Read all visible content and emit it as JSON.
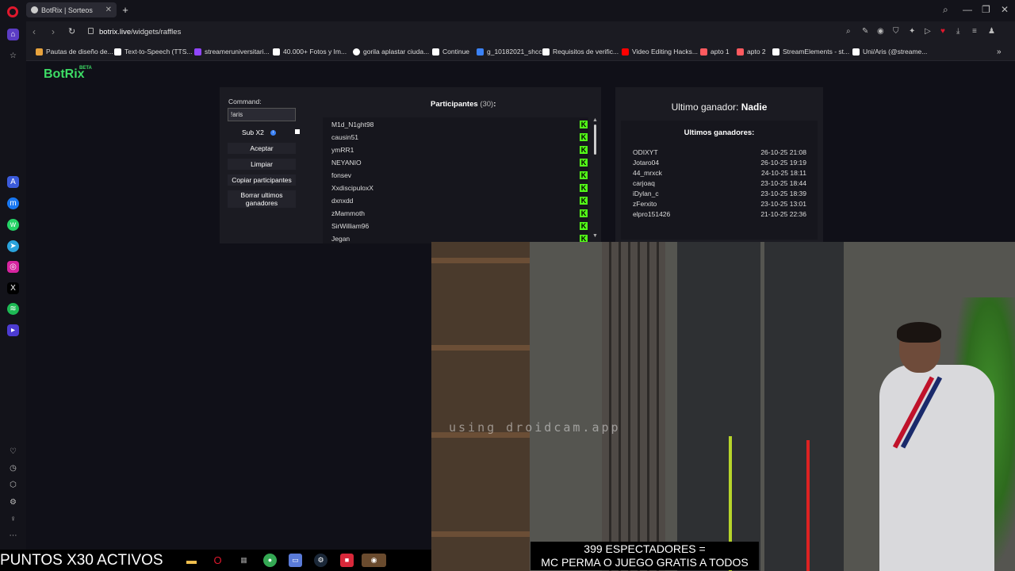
{
  "browser": {
    "tab_title": "BotRix | Sorteos",
    "url_host": "botrix.live",
    "url_path": "/widgets/raffles"
  },
  "bookmarks": [
    {
      "label": "Pautas de diseño de...",
      "icon": "bookmark-icon",
      "color": "#e8a33d"
    },
    {
      "label": "Text-to-Speech (TTS...",
      "icon": "tts-icon",
      "color": "#ffffff"
    },
    {
      "label": "streameruniversitari...",
      "icon": "twitch-icon",
      "color": "#9146ff"
    },
    {
      "label": "40.000+ Fotos y Im...",
      "icon": "pexels-icon",
      "color": "#ffffff"
    },
    {
      "label": "gorila aplastar ciuda...",
      "icon": "google-icon",
      "color": "#ffffff"
    },
    {
      "label": "Continue",
      "icon": "page-icon",
      "color": "#ffffff"
    },
    {
      "label": "g_10182021_shcc",
      "icon": "doc-icon",
      "color": "#3b82f6"
    },
    {
      "label": "Requisitos de verific...",
      "icon": "x-icon",
      "color": "#ffffff"
    },
    {
      "label": "Video Editing Hacks...",
      "icon": "youtube-icon",
      "color": "#ff0000"
    },
    {
      "label": "apto 1",
      "icon": "airbnb-icon",
      "color": "#ff5a5f"
    },
    {
      "label": "apto 2",
      "icon": "airbnb-icon",
      "color": "#ff5a5f"
    },
    {
      "label": "StreamElements - st...",
      "icon": "streamelements-icon",
      "color": "#ffffff"
    },
    {
      "label": "Uni/Aris (@streame...",
      "icon": "tiktok-icon",
      "color": "#ffffff"
    }
  ],
  "brand": {
    "name": "BotRix",
    "badge": "BETA",
    "color": "#3ddc65"
  },
  "raffle": {
    "command_label": "Command:",
    "command_value": "!aris",
    "sub_label": "Sub X2",
    "accept_label": "Aceptar",
    "clear_label": "Limpiar",
    "copy_label": "Copiar participantes",
    "delete_label": "Borrar ultimos ganadores",
    "participants_title": "Participantes",
    "participants_count": "(30)",
    "participants_colon": ":",
    "participants": [
      "M1d_N1ght98",
      "causin51",
      "ymRR1",
      "NEYANIO",
      "fonsev",
      "XxdiscipuloxX",
      "dxnxdd",
      "zMammoth",
      "SirWilliam96",
      "Jegan"
    ],
    "platform_icon": "kick-icon",
    "platform_letter": "K",
    "platform_color": "#53fc18"
  },
  "winners": {
    "last_winner_label": "Ultimo ganador:",
    "last_winner_value": "Nadie",
    "list_title": "Ultimos ganadores:",
    "list": [
      {
        "name": "ODIXYT",
        "date": "26-10-25 21:08"
      },
      {
        "name": "Jotaro04",
        "date": "26-10-25 19:19"
      },
      {
        "name": "44_mrxck",
        "date": "24-10-25 18:11"
      },
      {
        "name": "carjoaq",
        "date": "23-10-25 18:44"
      },
      {
        "name": "iDylan_c",
        "date": "23-10-25 18:39"
      },
      {
        "name": "zFerxito",
        "date": "23-10-25 13:01"
      },
      {
        "name": "elpro151426",
        "date": "21-10-25 22:36"
      }
    ]
  },
  "camera": {
    "watermark": "using droidcam.app",
    "overlay_line1": "399 ESPECTADORES =",
    "overlay_line2": "MC PERMA O JUEGO GRATIS A TODOS"
  },
  "taskbar": {
    "ticker": "PUNTOS X30 ACTIVOS",
    "apps": [
      {
        "icon": "file-explorer-icon",
        "color": "#f2c14e"
      },
      {
        "icon": "opera-icon",
        "color": "#e0182d"
      },
      {
        "icon": "app-launcher-icon",
        "color": "#888888"
      },
      {
        "icon": "chrome-icon",
        "color": "#34a853"
      },
      {
        "icon": "window-icon",
        "color": "#5a7bd8"
      },
      {
        "icon": "steam-icon",
        "color": "#1b2838"
      },
      {
        "icon": "red-app-icon",
        "color": "#d8283a"
      },
      {
        "icon": "obs-icon",
        "color": "#6a4b2e"
      }
    ]
  }
}
